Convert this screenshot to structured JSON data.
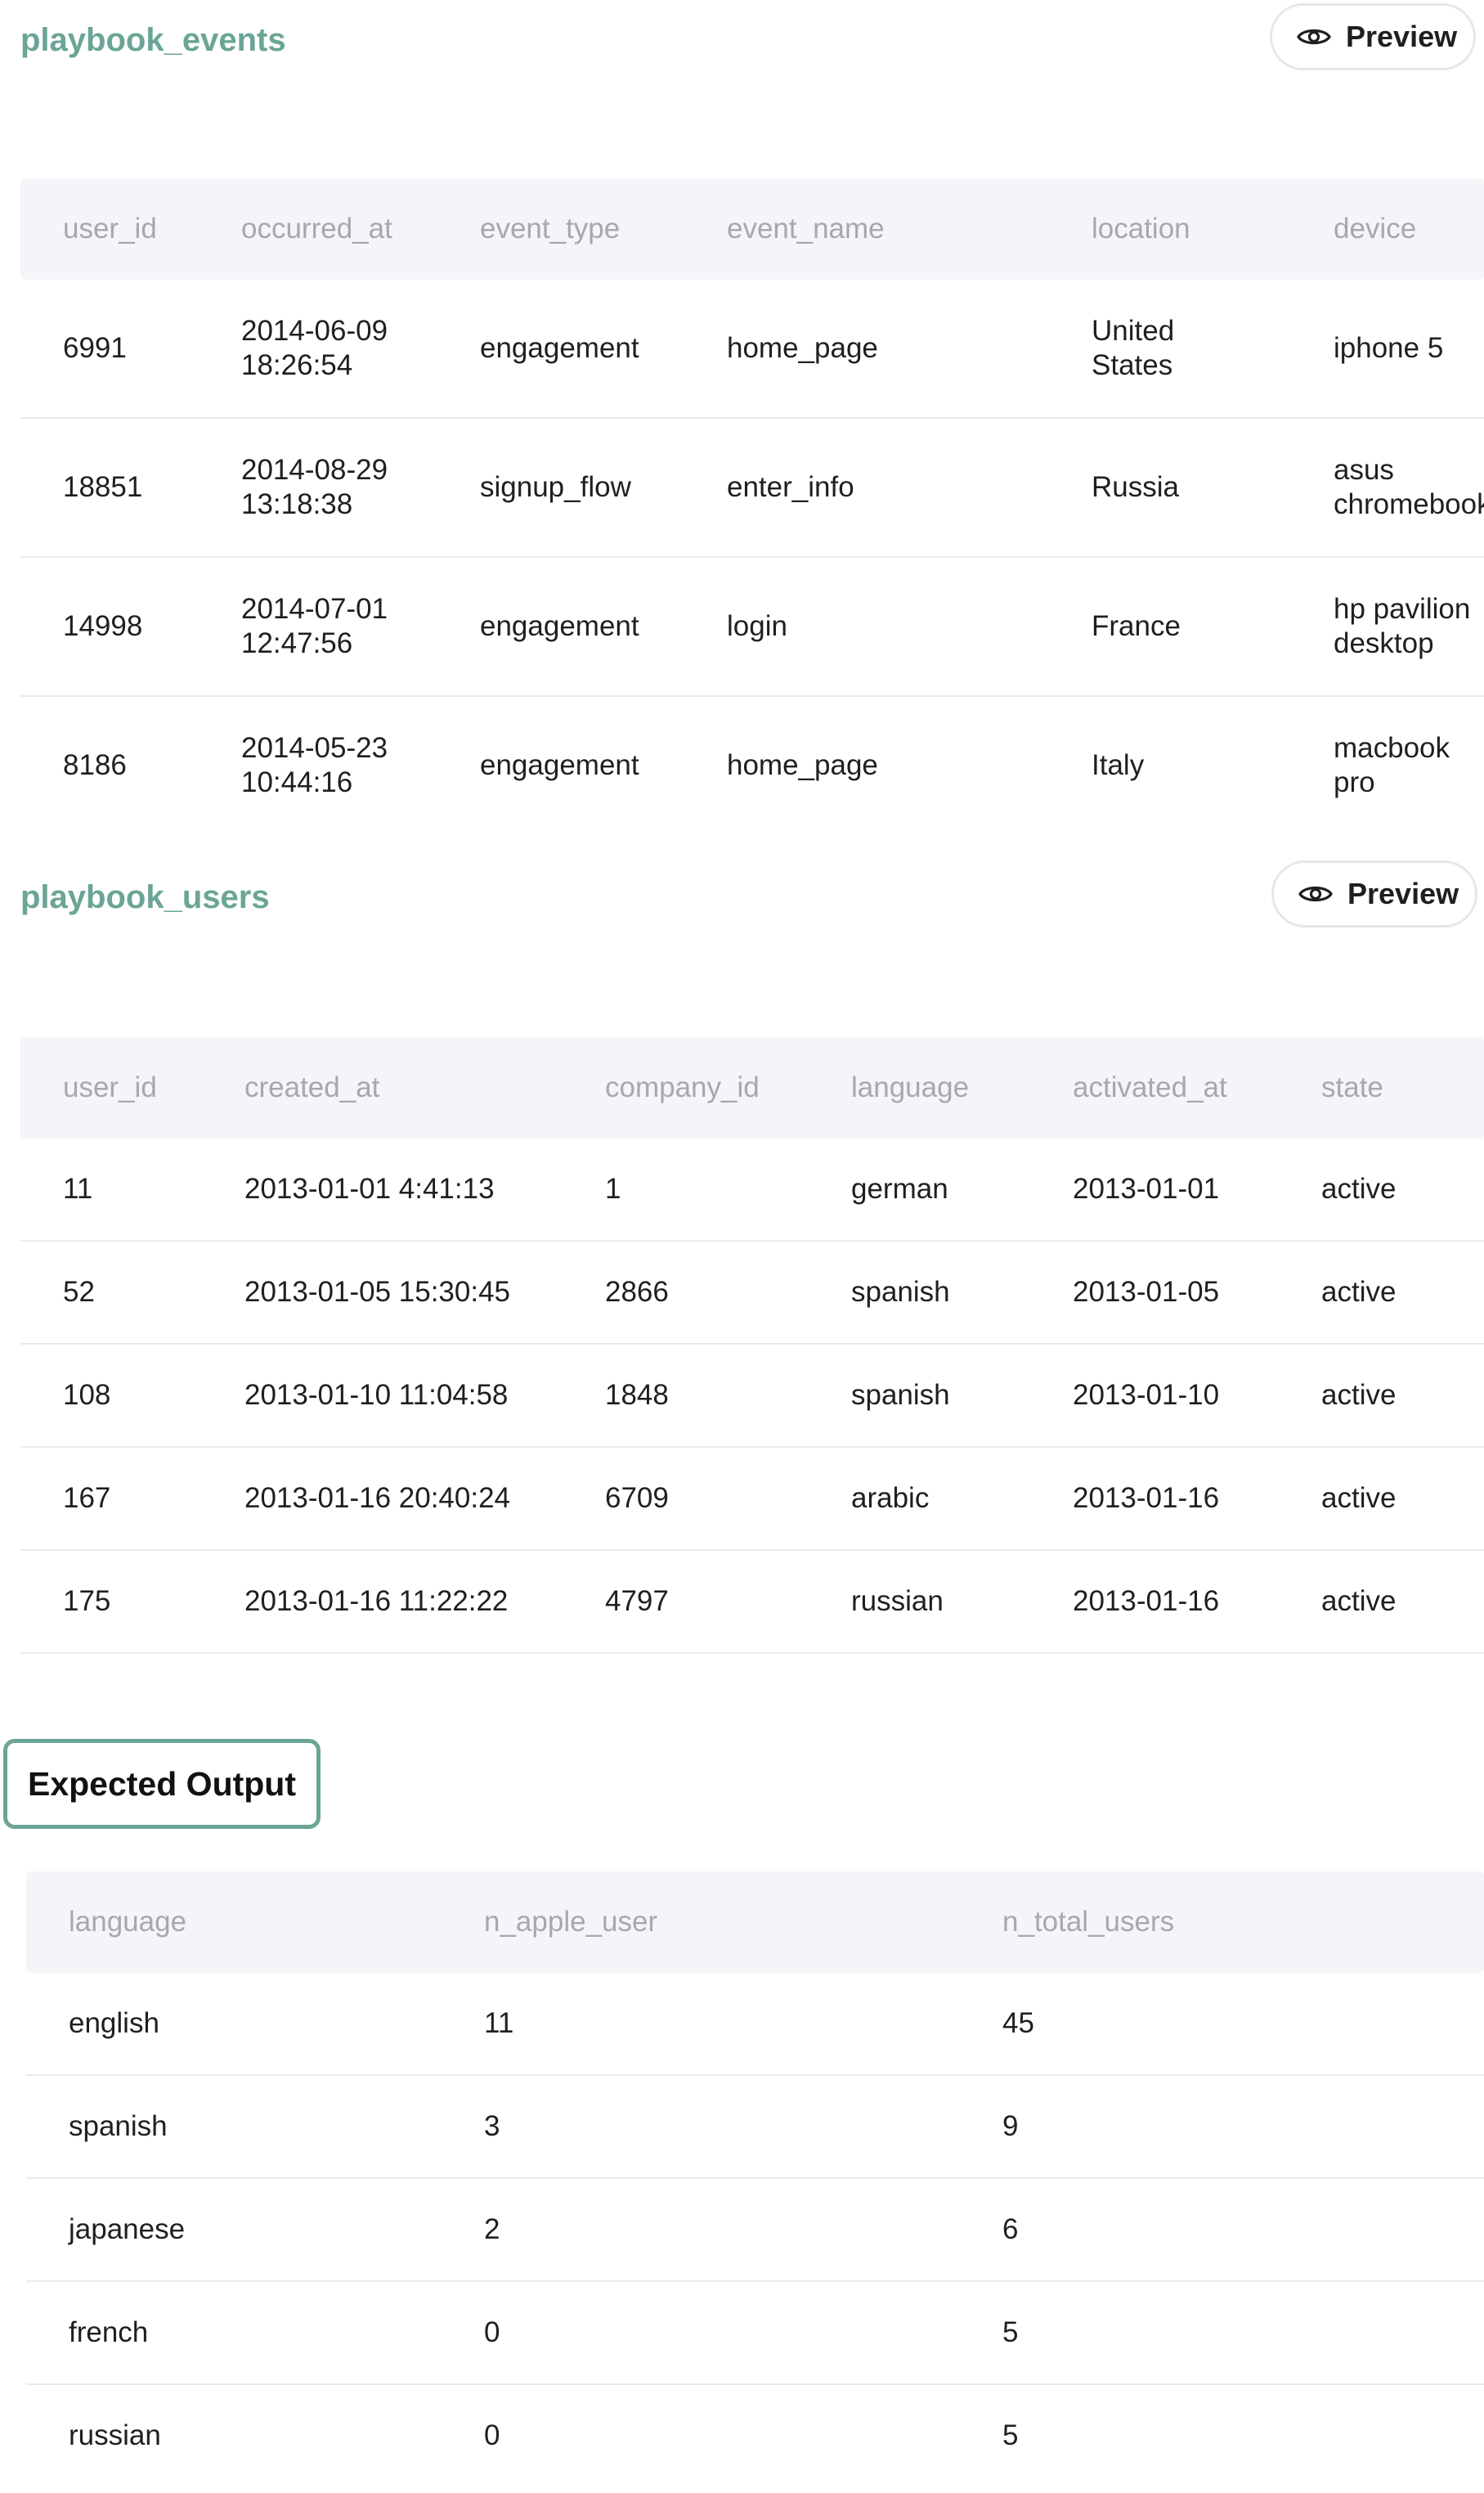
{
  "events": {
    "title": "playbook_events",
    "preview_label": "Preview",
    "columns": [
      "user_id",
      "occurred_at",
      "event_type",
      "event_name",
      "location",
      "device"
    ],
    "rows": [
      [
        "6991",
        "2014-06-09 18:26:54",
        "engagement",
        "home_page",
        "United States",
        "iphone 5"
      ],
      [
        "18851",
        "2014-08-29 13:18:38",
        "signup_flow",
        "enter_info",
        "Russia",
        "asus chromebook"
      ],
      [
        "14998",
        "2014-07-01 12:47:56",
        "engagement",
        "login",
        "France",
        "hp pavilion desktop"
      ],
      [
        "8186",
        "2014-05-23 10:44:16",
        "engagement",
        "home_page",
        "Italy",
        "macbook pro"
      ]
    ]
  },
  "users": {
    "title": "playbook_users",
    "preview_label": "Preview",
    "columns": [
      "user_id",
      "created_at",
      "company_id",
      "language",
      "activated_at",
      "state"
    ],
    "rows": [
      [
        "11",
        "2013-01-01 4:41:13",
        "1",
        "german",
        "2013-01-01",
        "active"
      ],
      [
        "52",
        "2013-01-05 15:30:45",
        "2866",
        "spanish",
        "2013-01-05",
        "active"
      ],
      [
        "108",
        "2013-01-10 11:04:58",
        "1848",
        "spanish",
        "2013-01-10",
        "active"
      ],
      [
        "167",
        "2013-01-16 20:40:24",
        "6709",
        "arabic",
        "2013-01-16",
        "active"
      ],
      [
        "175",
        "2013-01-16 11:22:22",
        "4797",
        "russian",
        "2013-01-16",
        "active"
      ]
    ]
  },
  "expected": {
    "tab_label": "Expected Output",
    "columns": [
      "language",
      "n_apple_user",
      "n_total_users"
    ],
    "rows": [
      [
        "english",
        "11",
        "45"
      ],
      [
        "spanish",
        "3",
        "9"
      ],
      [
        "japanese",
        "2",
        "6"
      ],
      [
        "french",
        "0",
        "5"
      ],
      [
        "russian",
        "0",
        "5"
      ]
    ]
  },
  "icons": {
    "preview": "eye-icon"
  },
  "colors": {
    "accent": "#6aa596",
    "header_bg": "#f4f5f8",
    "header_text": "#a6a8ae",
    "row_border": "#e9eaee"
  }
}
